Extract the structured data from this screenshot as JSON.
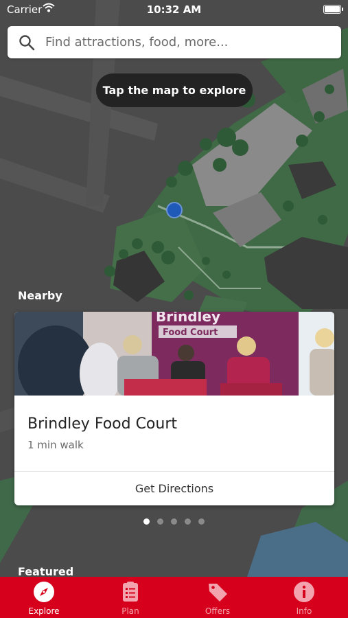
{
  "status_bar": {
    "carrier": "Carrier",
    "time": "10:32 AM"
  },
  "search": {
    "placeholder": "Find attractions, food, more..."
  },
  "map": {
    "hint": "Tap the map to explore"
  },
  "nearby": {
    "heading": "Nearby",
    "card": {
      "sign_line1": "Brindley",
      "sign_line2": "Food Court",
      "title": "Brindley Food Court",
      "subtitle": "1 min walk",
      "action_label": "Get Directions"
    },
    "page_count": 5,
    "active_page": 1
  },
  "featured": {
    "heading": "Featured"
  },
  "tabbar": {
    "tabs": [
      {
        "label": "Explore",
        "icon": "compass-icon",
        "active": true
      },
      {
        "label": "Plan",
        "icon": "checklist-icon",
        "active": false
      },
      {
        "label": "Offers",
        "icon": "tag-icon",
        "active": false
      },
      {
        "label": "Info",
        "icon": "info-icon",
        "active": false
      }
    ]
  },
  "colors": {
    "brand_red": "#d6001c",
    "map_road": "#4b4b4b",
    "map_grass": "#3f6a45",
    "location_dot": "#1f5ab8"
  }
}
